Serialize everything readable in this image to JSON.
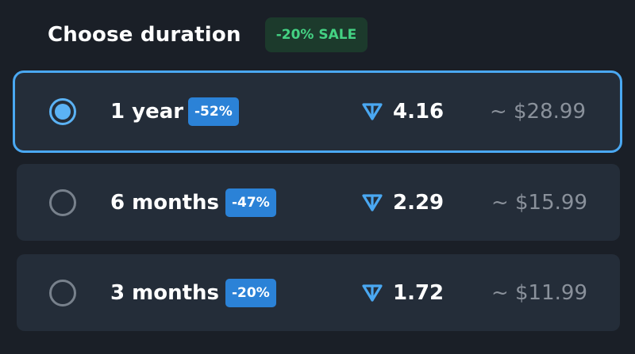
{
  "header": {
    "title": "Choose duration",
    "sale_badge": "-20% SALE"
  },
  "colors": {
    "background": "#1a1f27",
    "card": "#242d39",
    "accent": "#4aa8f2",
    "discount_badge": "#2b82d7",
    "sale_text": "#44d283",
    "usd_text": "#8a919b"
  },
  "options": [
    {
      "label": "1 year",
      "discount": "-52%",
      "ton_icon": "ton-icon",
      "ton_amount": "4.16",
      "usd_price": "~ $28.99",
      "selected": true
    },
    {
      "label": "6 months",
      "discount": "-47%",
      "ton_icon": "ton-icon",
      "ton_amount": "2.29",
      "usd_price": "~ $15.99",
      "selected": false
    },
    {
      "label": "3 months",
      "discount": "-20%",
      "ton_icon": "ton-icon",
      "ton_amount": "1.72",
      "usd_price": "~ $11.99",
      "selected": false
    }
  ]
}
